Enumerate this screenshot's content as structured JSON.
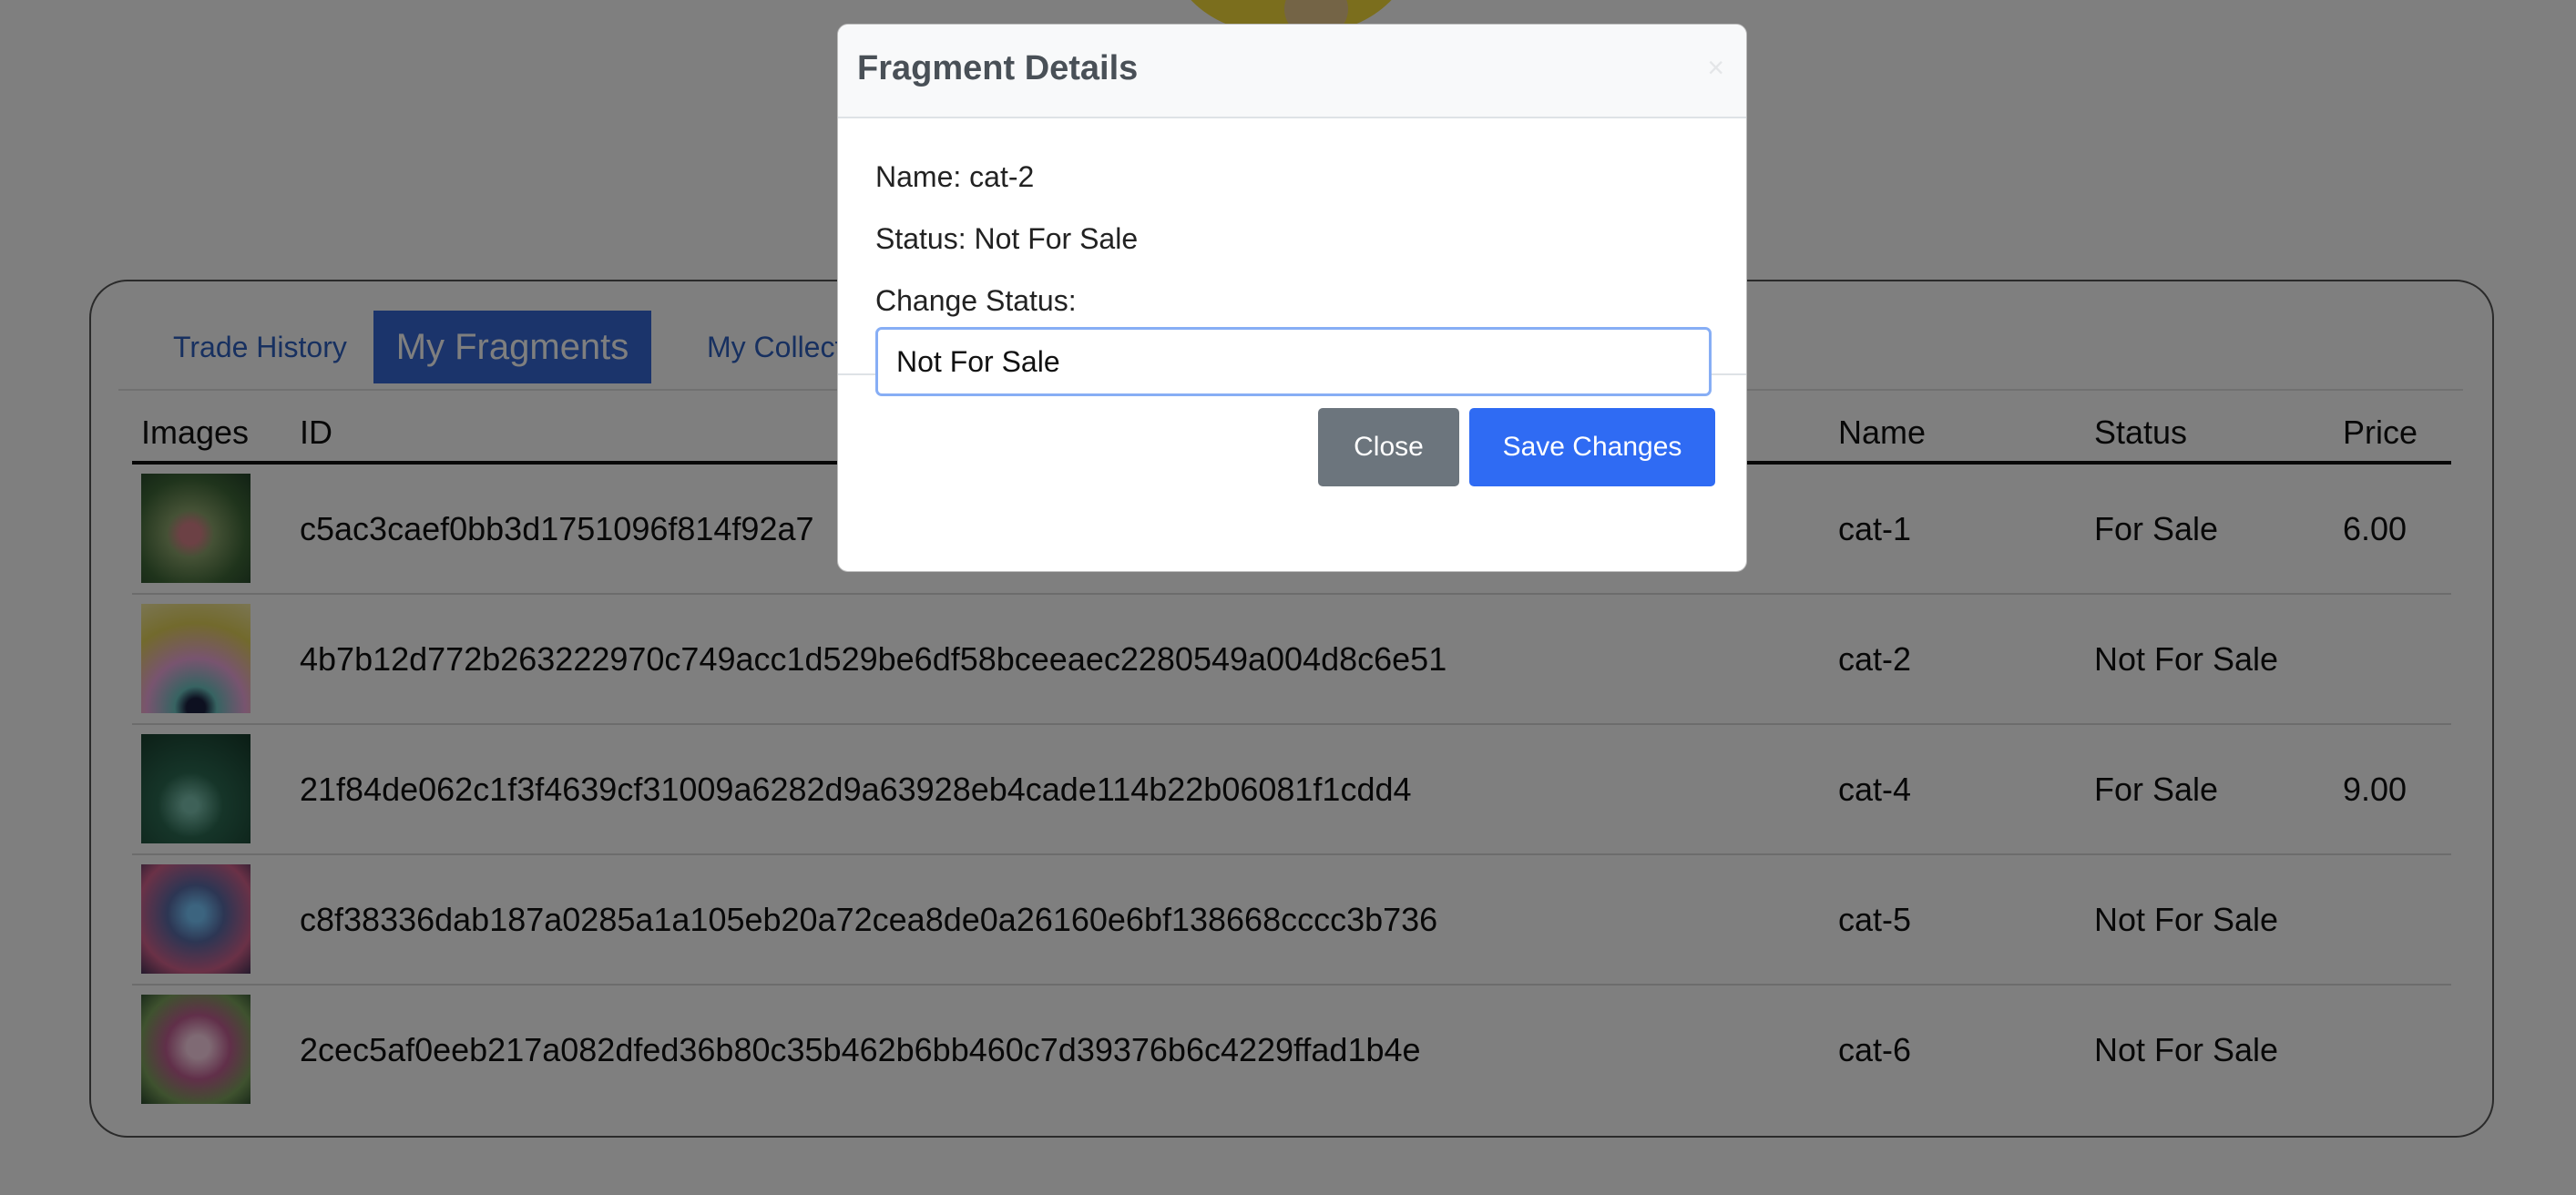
{
  "tabs": [
    {
      "label": "Trade History"
    },
    {
      "label": "My Fragments"
    },
    {
      "label": "My Collecti"
    }
  ],
  "table": {
    "headers": {
      "images": "Images",
      "id": "ID",
      "name": "Name",
      "status": "Status",
      "price": "Price"
    },
    "rows": [
      {
        "id": "c5ac3caef0bb3d1751096f814f92a7",
        "name": "cat-1",
        "status": "For Sale",
        "price": "6.00",
        "image": "cat-1-thumbnail"
      },
      {
        "id": "4b7b12d772b263222970c749acc1d529be6df58bceeaec2280549a004d8c6e51",
        "name": "cat-2",
        "status": "Not For Sale",
        "price": "",
        "image": "cat-2-thumbnail"
      },
      {
        "id": "21f84de062c1f3f4639cf31009a6282d9a63928eb4cade114b22b06081f1cdd4",
        "name": "cat-4",
        "status": "For Sale",
        "price": "9.00",
        "image": "cat-4-thumbnail"
      },
      {
        "id": "c8f38336dab187a0285a1a105eb20a72cea8de0a26160e6bf138668cccc3b736",
        "name": "cat-5",
        "status": "Not For Sale",
        "price": "",
        "image": "cat-5-thumbnail"
      },
      {
        "id": "2cec5af0eeb217a082dfed36b80c35b462b6bb460c7d39376b6c4229ffad1b4e",
        "name": "cat-6",
        "status": "Not For Sale",
        "price": "",
        "image": "cat-6-thumbnail"
      }
    ]
  },
  "modal": {
    "title": "Fragment Details",
    "name_line": "Name: cat-2",
    "status_line": "Status: Not For Sale",
    "change_status_label": "Change Status:",
    "select_value": "Not For Sale",
    "close_label": "Close",
    "save_label": "Save Changes",
    "close_icon": "×"
  },
  "colors": {
    "overlay": "#808080",
    "primary_button": "#2f6bf3",
    "secondary_button": "#6c757d",
    "active_tab": "#3769d6"
  }
}
